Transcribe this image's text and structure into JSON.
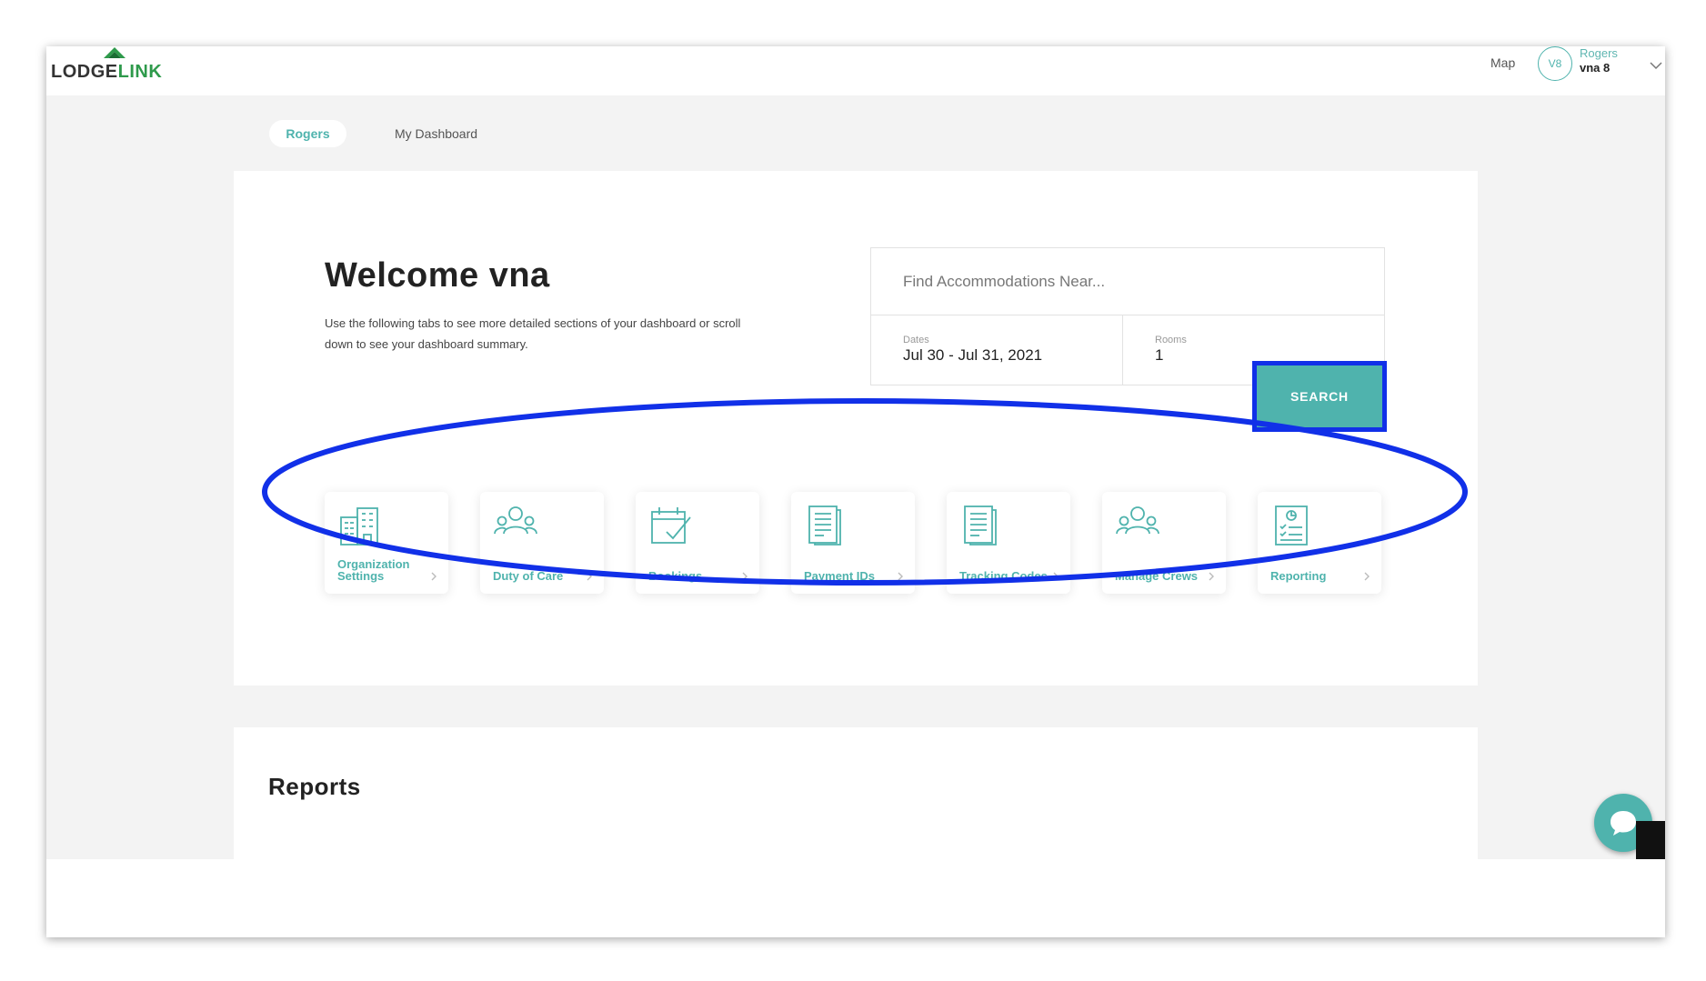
{
  "brand": {
    "logo_text_1": "LODGE",
    "logo_text_2": "LINK",
    "accent_color": "#4fb3ad",
    "logo_green": "#2e9a4b"
  },
  "header": {
    "map_label": "Map",
    "avatar_initials": "V8",
    "user_org": "Rogers",
    "user_name": "vna 8",
    "caret_icon": "chevron-down-icon"
  },
  "tabs": [
    {
      "label": "Rogers",
      "active": true
    },
    {
      "label": "My Dashboard",
      "active": false
    }
  ],
  "welcome": {
    "title": "Welcome vna",
    "description": "Use the following tabs to see more detailed sections of your dashboard or scroll down to see your dashboard summary."
  },
  "search": {
    "placeholder": "Find Accommodations Near...",
    "dates_label": "Dates",
    "dates_value": "Jul 30 - Jul 31, 2021",
    "rooms_label": "Rooms",
    "rooms_value": "1",
    "button_label": "SEARCH",
    "highlight_color": "#1130e8"
  },
  "tiles": [
    {
      "label": "Organization Settings",
      "icon": "building-icon"
    },
    {
      "label": "Duty of Care",
      "icon": "people-icon"
    },
    {
      "label": "Bookings",
      "icon": "calendar-check-icon"
    },
    {
      "label": "Payment IDs",
      "icon": "document-icon"
    },
    {
      "label": "Tracking Codes",
      "icon": "document-icon"
    },
    {
      "label": "Manage Crews",
      "icon": "people-icon"
    },
    {
      "label": "Reporting",
      "icon": "report-clipboard-icon"
    }
  ],
  "annotation": {
    "color": "#1130e8"
  },
  "reports": {
    "title": "Reports"
  },
  "chat": {
    "icon": "chat-bubble-icon"
  }
}
